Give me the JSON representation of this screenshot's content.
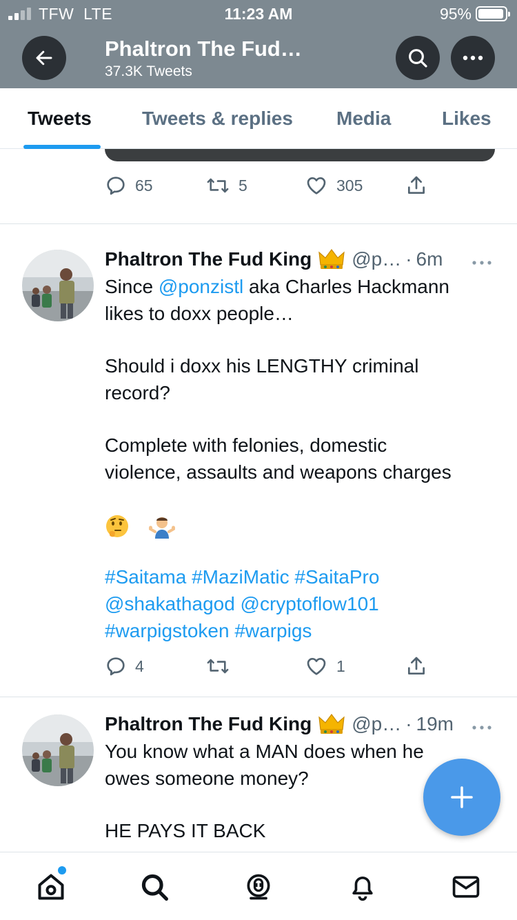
{
  "status_bar": {
    "carrier": "TFW",
    "network": "LTE",
    "time": "11:23 AM",
    "battery": "95%"
  },
  "header": {
    "name": "Phaltron The Fud…",
    "tweet_count": "37.3K Tweets"
  },
  "tabs": [
    {
      "label": "Tweets",
      "active": true
    },
    {
      "label": "Tweets & replies",
      "active": false
    },
    {
      "label": "Media",
      "active": false
    },
    {
      "label": "Likes",
      "active": false
    }
  ],
  "prev_tweet": {
    "replies": "65",
    "retweets": "5",
    "likes": "305"
  },
  "tweets": [
    {
      "name": "Phaltron The Fud King",
      "handle": "@p…",
      "time": "6m",
      "text": {
        "l1_pre": "Since ",
        "l1_mention": "@ponzistl",
        "l1_post": " aka Charles Hackmann",
        "l2": "likes to doxx people…",
        "l3": "Should i doxx his LENGTHY criminal",
        "l4": "record?",
        "l5": "Complete with felonies, domestic",
        "l6": "violence, assaults and weapons charges",
        "l7": "#Saitama #MaziMatic #SaitaPro",
        "l8": "@shakathagod @cryptoflow101",
        "l9": "#warpigstoken #warpigs"
      },
      "emojis": [
        "thinking-face",
        "man-shrugging"
      ],
      "replies": "4",
      "retweets": "",
      "likes": "1"
    },
    {
      "name": "Phaltron The Fud King",
      "handle": "@p…",
      "time": "19m",
      "text": {
        "l1": "You know what a MAN does when he",
        "l2": "owes someone money?",
        "l3": "HE PAYS IT BACK"
      }
    }
  ],
  "colors": {
    "header_bg": "#7d8991",
    "accent": "#1d9bf0",
    "fab": "#4a99e9"
  },
  "icons": [
    "back-arrow-icon",
    "search-icon",
    "more-icon",
    "reply-icon",
    "retweet-icon",
    "like-icon",
    "share-icon",
    "compose-plus-icon",
    "home-icon",
    "explore-icon",
    "spaces-icon",
    "notifications-icon",
    "messages-icon"
  ]
}
